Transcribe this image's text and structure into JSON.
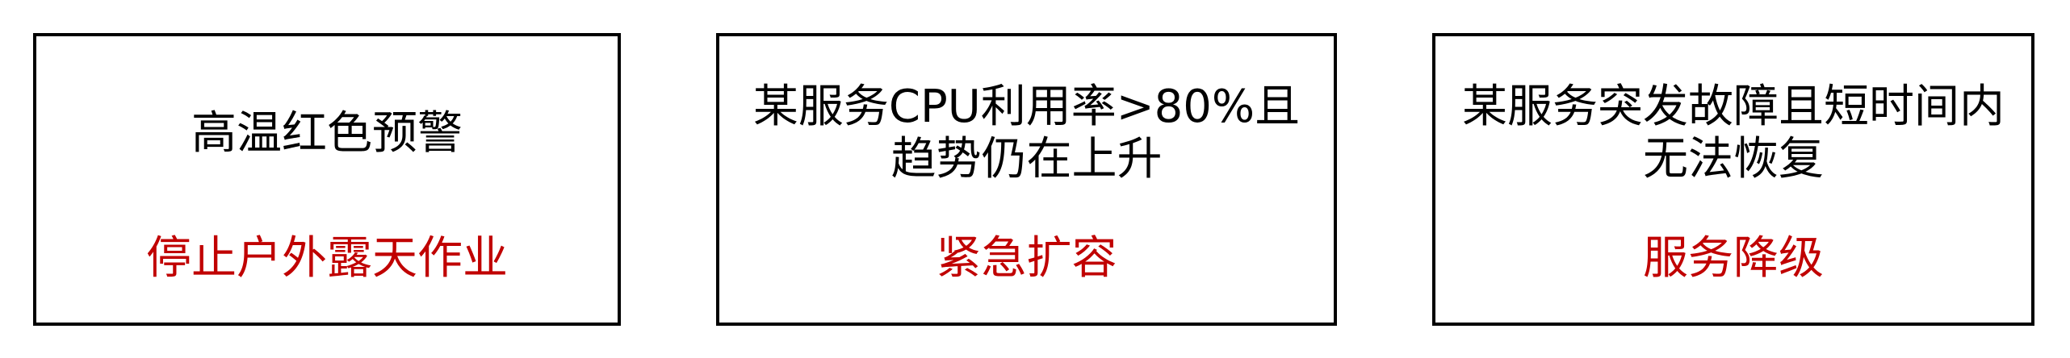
{
  "colors": {
    "border": "#000000",
    "condition_text": "#000000",
    "action_text": "#c00000",
    "background": "#ffffff"
  },
  "cards": [
    {
      "condition": "高温红色预警",
      "action": "停止户外露天作业"
    },
    {
      "condition": "某服务CPU利用率>80%且趋势仍在上升",
      "action": "紧急扩容"
    },
    {
      "condition": "某服务突发故障且短时间内无法恢复",
      "action": "服务降级"
    }
  ]
}
